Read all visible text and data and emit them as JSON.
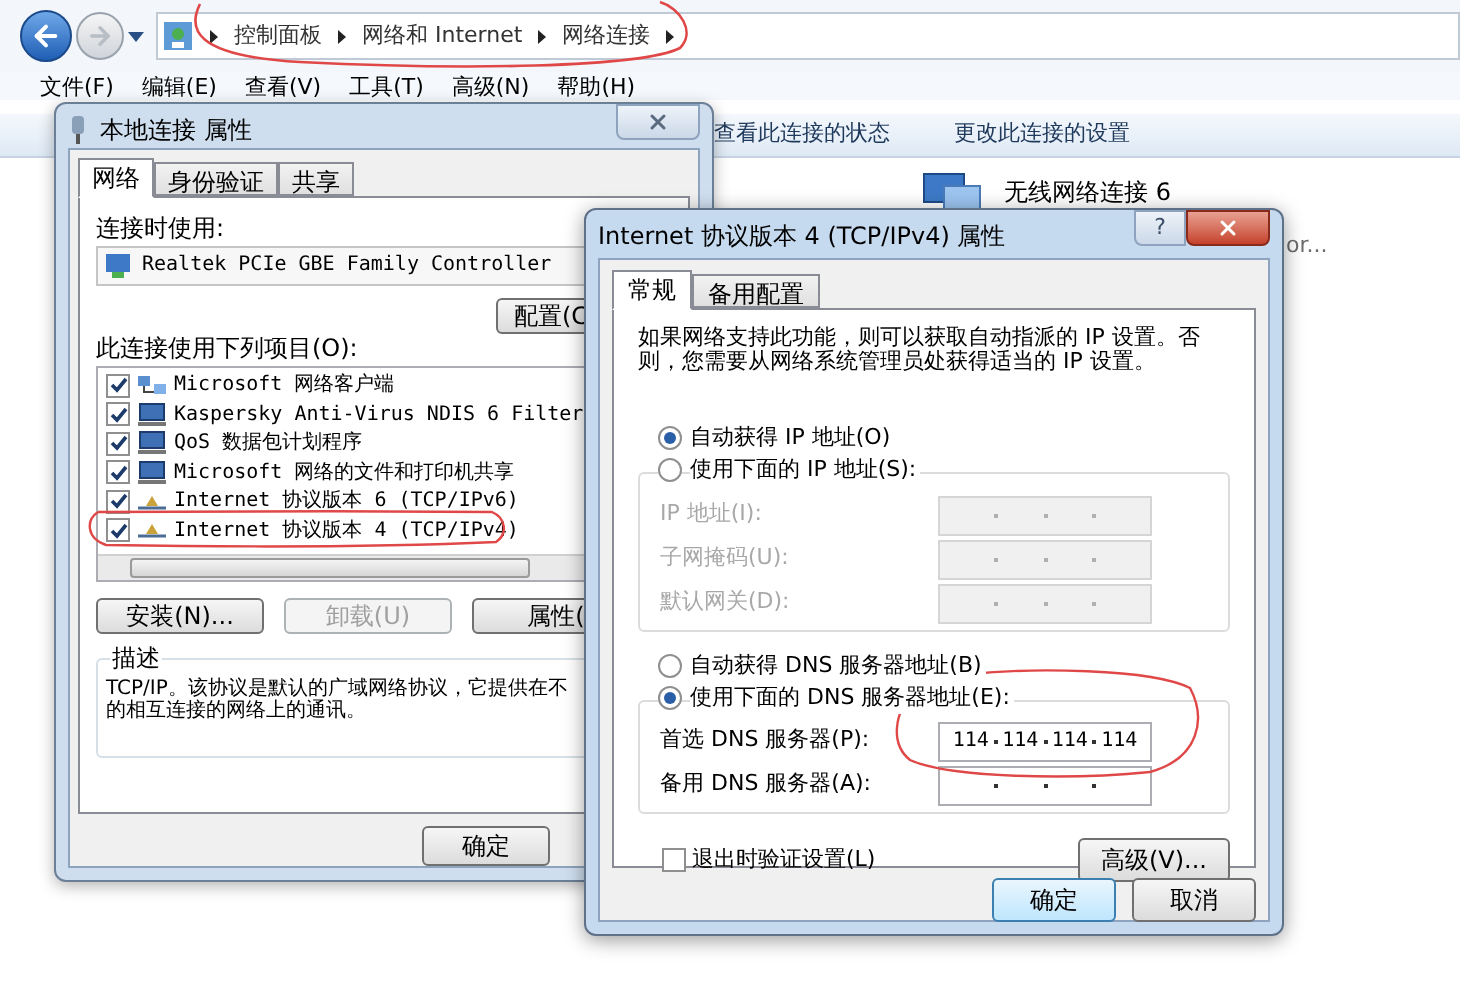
{
  "explorer": {
    "breadcrumbs": [
      "控制面板",
      "网络和 Internet",
      "网络连接"
    ],
    "menu": [
      "文件(F)",
      "编辑(E)",
      "查看(V)",
      "工具(T)",
      "高级(N)",
      "帮助(H)"
    ],
    "toolbar": [
      "查看此连接的状态",
      "更改此连接的设置"
    ],
    "connections": [
      {
        "name": "无线网络连接 6"
      }
    ],
    "partial_text": "or..."
  },
  "local_connection_dialog": {
    "title": "本地连接 属性",
    "tabs": [
      {
        "label": "网络",
        "selected": true
      },
      {
        "label": "身份验证",
        "selected": false
      },
      {
        "label": "共享",
        "selected": false
      }
    ],
    "connect_using_label": "连接时使用:",
    "adapter": "Realtek PCIe GBE Family Controller",
    "configure_button": "配置(C",
    "items_label": "此连接使用下列项目(O):",
    "items": [
      {
        "label": "Microsoft 网络客户端",
        "checked": true,
        "kind": "client"
      },
      {
        "label": "Kaspersky Anti-Virus NDIS 6 Filter",
        "checked": true,
        "kind": "service"
      },
      {
        "label": "QoS 数据包计划程序",
        "checked": true,
        "kind": "service"
      },
      {
        "label": "Microsoft 网络的文件和打印机共享",
        "checked": true,
        "kind": "service"
      },
      {
        "label": "Internet 协议版本 6 (TCP/IPv6)",
        "checked": true,
        "kind": "protocol"
      },
      {
        "label": "Internet 协议版本 4 (TCP/IPv4)",
        "checked": true,
        "kind": "protocol"
      }
    ],
    "buttons": [
      {
        "label": "安装(N)...",
        "disabled": false
      },
      {
        "label": "卸载(U)",
        "disabled": true
      },
      {
        "label": "属性(",
        "disabled": false
      }
    ],
    "description_label": "描述",
    "description_lines": [
      "TCP/IP。该协议是默认的广域网络协议，它提供在不",
      "的相互连接的网络上的通讯。"
    ],
    "ok_button": "确定"
  },
  "ipv4_dialog": {
    "title": "Internet 协议版本 4 (TCP/IPv4) 属性",
    "help_button": "?",
    "tabs": [
      {
        "label": "常规",
        "selected": true
      },
      {
        "label": "备用配置",
        "selected": false
      }
    ],
    "intro": "如果网络支持此功能，则可以获取自动指派的 IP 设置。否则，您需要从网络系统管理员处获得适当的 IP 设置。",
    "ip_radios": [
      {
        "label": "自动获得 IP 地址(O)",
        "selected": true
      },
      {
        "label": "使用下面的 IP 地址(S):",
        "selected": false
      }
    ],
    "ip_fields": [
      {
        "label": "IP 地址(I):",
        "disabled": true
      },
      {
        "label": "子网掩码(U):",
        "disabled": true
      },
      {
        "label": "默认网关(D):",
        "disabled": true
      }
    ],
    "dns_radios": [
      {
        "label": "自动获得 DNS 服务器地址(B)",
        "selected": false
      },
      {
        "label": "使用下面的 DNS 服务器地址(E):",
        "selected": true
      }
    ],
    "dns_fields": [
      {
        "label": "首选 DNS 服务器(P):",
        "disabled": false,
        "octets": [
          "114",
          "114",
          "114",
          "114"
        ]
      },
      {
        "label": "备用 DNS 服务器(A):",
        "disabled": false
      }
    ],
    "validate_checkbox": {
      "label": "退出时验证设置(L)",
      "checked": false
    },
    "advanced_button": "高级(V)...",
    "ok_button": "确定",
    "cancel_button": "取消"
  }
}
